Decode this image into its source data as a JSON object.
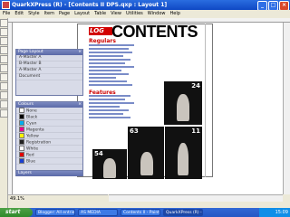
{
  "window": {
    "title": "QuarkXPress (R) - [Contents II DPS.qxp : Layout 1]"
  },
  "menu": [
    "File",
    "Edit",
    "Style",
    "Item",
    "Page",
    "Layout",
    "Table",
    "View",
    "Utilities",
    "Window",
    "Help"
  ],
  "document": {
    "logo": "LOG",
    "contents_title": "CONTENTS",
    "section_regulars": "Regulars",
    "section_features": "Features",
    "photo_numbers": [
      "24",
      "54",
      "63",
      "11"
    ]
  },
  "palettes": {
    "layout": {
      "title": "Page Layout",
      "rows": [
        "A-Master A",
        "B-Master B",
        "A-Master A",
        "Document"
      ]
    },
    "colours": {
      "title": "Colours",
      "rows": [
        "None",
        "Black",
        "Cyan",
        "Magenta",
        "Yellow",
        "Registration",
        "White",
        "Red",
        "Blue"
      ],
      "swatch_colors": [
        "#ffffff",
        "#000000",
        "#00aeef",
        "#ec008c",
        "#fff200",
        "#222222",
        "#ffffff",
        "#e00000",
        "#1a3fd1"
      ]
    },
    "layers": {
      "title": "Layers"
    }
  },
  "status": {
    "zoom": "49.1%"
  },
  "taskbar": {
    "start": "start",
    "tasks": [
      "Blogger: All entries",
      "AS MEDIA",
      "Contents II - Paint",
      "QuarkXPress (R) - [Co"
    ],
    "clock": "15:09"
  }
}
